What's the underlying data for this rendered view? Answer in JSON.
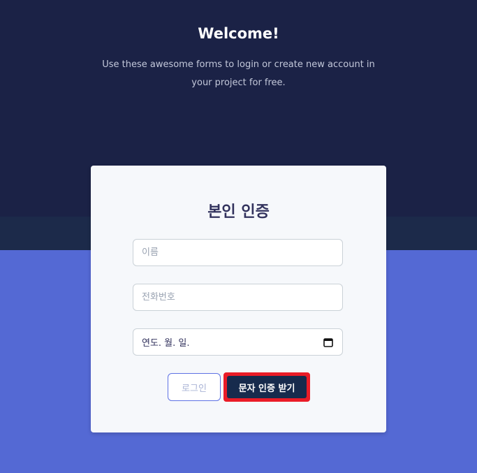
{
  "header": {
    "title": "Welcome!",
    "subtitle": "Use these awesome forms to login or create new account in your project for free."
  },
  "form": {
    "title": "본인 인증",
    "name_placeholder": "이름",
    "phone_placeholder": "전화번호",
    "date_value": "연도. 월. 일.",
    "date_icon": "calendar-icon",
    "login_label": "로그인",
    "sms_label": "문자 인증 받기"
  },
  "colors": {
    "hero_bg": "#1b2246",
    "page_bg": "#5469d4",
    "primary_button": "#172b4d",
    "highlight_border": "#ea1c27",
    "outline_button_border": "#5e72e4"
  }
}
